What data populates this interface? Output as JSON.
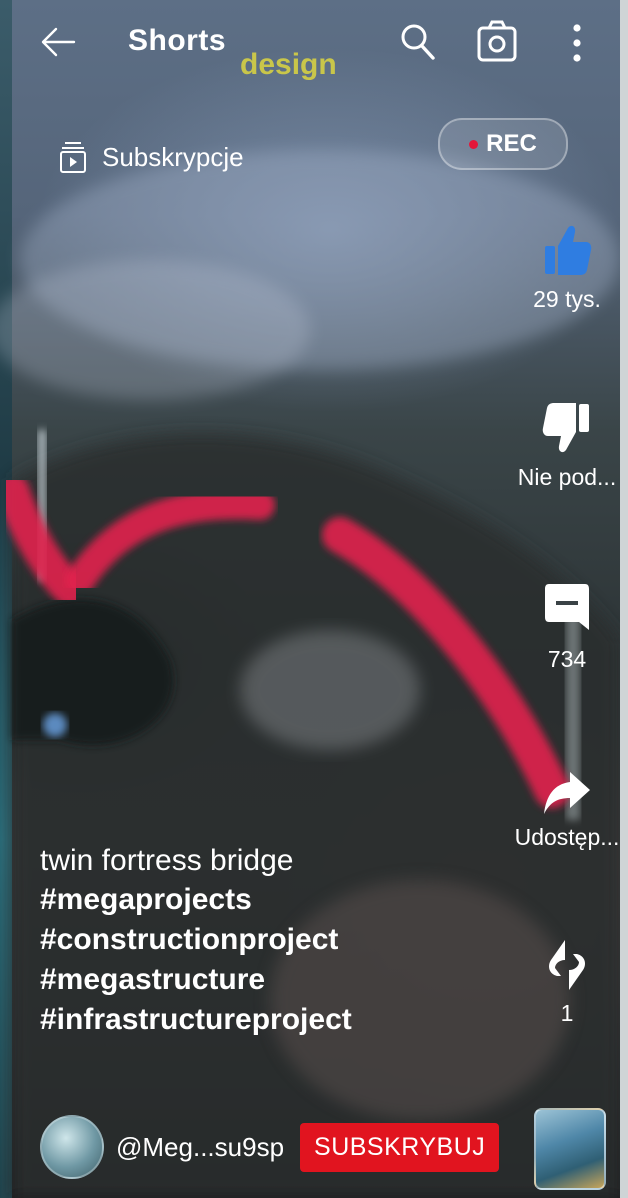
{
  "header": {
    "title": "Shorts",
    "overlay_text": "design"
  },
  "rec_badge": {
    "label": "REC"
  },
  "subscriptions": {
    "label": "Subskrypcje"
  },
  "actions": {
    "like": {
      "label": "29 tys.",
      "icon": "thumbs-up-icon",
      "color": "#2f7de1"
    },
    "dislike": {
      "label": "Nie pod...",
      "icon": "thumbs-down-icon"
    },
    "comments": {
      "label": "734",
      "icon": "comment-icon"
    },
    "share": {
      "label": "Udostęp...",
      "icon": "share-icon"
    },
    "remix": {
      "label": "1",
      "icon": "remix-icon"
    }
  },
  "caption": {
    "title": "twin fortress bridge",
    "hashtags": [
      "#megaprojects",
      "#constructionproject",
      "#megastructure",
      "#infrastructureproject"
    ]
  },
  "channel": {
    "handle": "@Meg...su9sp",
    "subscribe_label": "SUBSKRYBUJ",
    "subscribe_color": "#e1141f"
  }
}
